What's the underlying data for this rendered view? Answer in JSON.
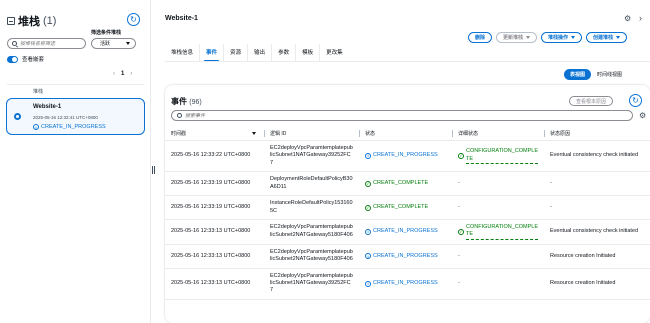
{
  "left": {
    "title": "堆栈",
    "count": "(1)",
    "filter_label": "筛选条件堆栈",
    "search_placeholder": "按堆栈名称筛选",
    "select_value": "活跃",
    "toggle_label": "查看嵌套",
    "page_current": "1",
    "column_label": "堆栈",
    "stack": {
      "name": "Website-1",
      "time": "2025-05-16 12:32:41 UTC+0800",
      "status": "CREATE_IN_PROGRESS"
    }
  },
  "header": {
    "title": "Website-1",
    "buttons": {
      "delete": "删除",
      "update": "更新堆栈",
      "stack_actions": "堆栈操作",
      "create_stack": "创建堆栈"
    }
  },
  "tabs": [
    "堆栈信息",
    "事件",
    "资源",
    "输出",
    "参数",
    "模板",
    "更改集"
  ],
  "view_toggle": {
    "table": "表视图",
    "timeline": "时间线视图"
  },
  "events": {
    "title": "事件",
    "count": "(96)",
    "root_cause_btn": "查看根本原因",
    "search_placeholder": "搜索事件",
    "columns": [
      "时间戳",
      "逻辑 ID",
      "状态",
      "详细状态",
      "状态原因"
    ],
    "rows": [
      {
        "time": "2025-05-16 12:33:22 UTC+0800",
        "logical_id": "EC2deployVpcParamtemplatepublicSubnet1NATGateway39252FC7",
        "status": "CREATE_IN_PROGRESS",
        "status_type": "progress",
        "detail": "CONFIGURATION_COMPLETE",
        "reason": "Eventual consistency check initiated"
      },
      {
        "time": "2025-05-16 12:33:19 UTC+0800",
        "logical_id": "DeploymentRoleDefaultPolicyB30A6D11",
        "status": "CREATE_COMPLETE",
        "status_type": "complete",
        "detail": "-",
        "reason": "-"
      },
      {
        "time": "2025-05-16 12:33:19 UTC+0800",
        "logical_id": "InstanceRoleDefaultPolicy1531605C",
        "status": "CREATE_COMPLETE",
        "status_type": "complete",
        "detail": "-",
        "reason": "-"
      },
      {
        "time": "2025-05-16 12:33:13 UTC+0800",
        "logical_id": "EC2deployVpcParamtemplatepublicSubnet2NATGateway5180F406",
        "status": "CREATE_IN_PROGRESS",
        "status_type": "progress",
        "detail": "CONFIGURATION_COMPLETE",
        "reason": "Eventual consistency check initiated"
      },
      {
        "time": "2025-05-16 12:33:13 UTC+0800",
        "logical_id": "EC2deployVpcParamtemplatepublicSubnet2NATGateway5180F406",
        "status": "CREATE_IN_PROGRESS",
        "status_type": "progress",
        "detail": "-",
        "reason": "Resource creation Initiated"
      },
      {
        "time": "2025-05-16 12:33:13 UTC+0800",
        "logical_id": "EC2deployVpcParamtemplatepublicSubnet1NATGateway39252FC7",
        "status": "CREATE_IN_PROGRESS",
        "status_type": "progress",
        "detail": "-",
        "reason": "Resource creation Initiated"
      }
    ]
  }
}
